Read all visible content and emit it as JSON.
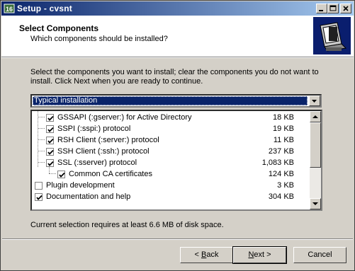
{
  "window": {
    "title": "Setup - cvsnt"
  },
  "header": {
    "title": "Select Components",
    "subtitle": "Which components should be installed?"
  },
  "intro_text": "Select the components you want to install; clear the components you do not want to install. Click Next when you are ready to continue.",
  "install_type": {
    "selected": "Typical installation"
  },
  "components": [
    {
      "label": "GSSAPI (:gserver:) for Active Directory",
      "size": "18 KB",
      "checked": true
    },
    {
      "label": "SSPI (:sspi:) protocol",
      "size": "19 KB",
      "checked": true
    },
    {
      "label": "RSH Client (:server:) protocol",
      "size": "11 KB",
      "checked": true
    },
    {
      "label": "SSH Client (:ssh:) protocol",
      "size": "237 KB",
      "checked": true
    },
    {
      "label": "SSL (:sserver) protocol",
      "size": "1,083 KB",
      "checked": true
    },
    {
      "label": "Common CA certificates",
      "size": "124 KB",
      "checked": true
    },
    {
      "label": "Plugin development",
      "size": "3 KB",
      "checked": false
    },
    {
      "label": "Documentation and help",
      "size": "304 KB",
      "checked": true
    }
  ],
  "status_text": "Current selection requires at least 6.6 MB of disk space.",
  "buttons": {
    "back_prefix": "< ",
    "back_key": "B",
    "back_rest": "ack",
    "next_key": "N",
    "next_rest": "ext >",
    "cancel": "Cancel"
  },
  "colors": {
    "titlebar_start": "#0a246a",
    "titlebar_end": "#a6caf0",
    "selection": "#0a246a",
    "face": "#d4d0c8"
  }
}
